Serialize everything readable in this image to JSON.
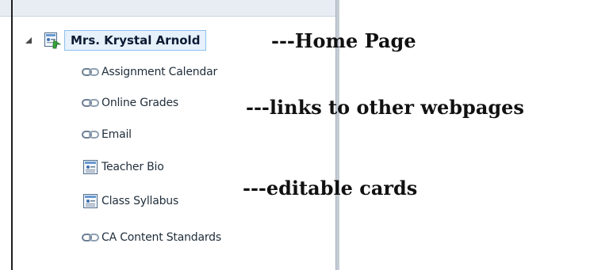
{
  "tree": {
    "root": {
      "label": "Mrs. Krystal Arnold",
      "icon": "page-with-green-arrow-icon",
      "expander_icon": "expanded-triangle-icon"
    },
    "items": [
      {
        "label": "Assignment Calendar",
        "icon": "link-chain-icon"
      },
      {
        "label": "Online Grades",
        "icon": "link-chain-icon"
      },
      {
        "label": "Email",
        "icon": "link-chain-icon"
      },
      {
        "label": "Teacher Bio",
        "icon": "card-page-icon"
      },
      {
        "label": "Class Syllabus",
        "icon": "card-page-icon"
      },
      {
        "label": "CA Content Standards",
        "icon": "link-chain-icon"
      }
    ]
  },
  "annotations": {
    "home_page": "---Home Page",
    "links": "---links to other webpages",
    "cards": "---editable cards"
  }
}
